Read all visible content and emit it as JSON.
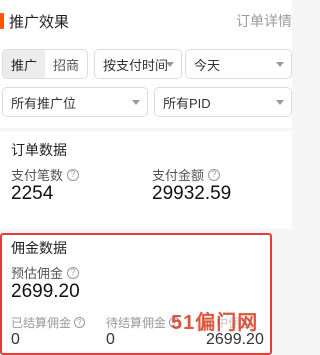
{
  "header": {
    "title": "推广效果",
    "link": "订单详情"
  },
  "segment": {
    "items": [
      "推广",
      "招商"
    ],
    "active": "推广"
  },
  "filters": {
    "pay_time": "按支付时间",
    "date_range": "今天",
    "promo_position": "所有推广位",
    "pid": "所有PID"
  },
  "orders": {
    "title": "订单数据",
    "count_label": "支付笔数",
    "count_value": "2254",
    "amount_label": "支付金额",
    "amount_value": "29932.59"
  },
  "commission": {
    "title": "佣金数据",
    "estimated_label": "预估佣金",
    "estimated_value": "2699.20",
    "settled_label": "已结算佣金",
    "settled_value": "0",
    "pending_label": "待结算佣金",
    "pending_value": "0",
    "third_label": "中佣金",
    "third_value": "2699.20"
  },
  "watermark": "51偏门网",
  "colors": {
    "accent": "#ff5500",
    "highlight_border": "#e43d3d"
  },
  "icons": {
    "help": "question-circle-icon",
    "caret": "caret-down-icon"
  }
}
